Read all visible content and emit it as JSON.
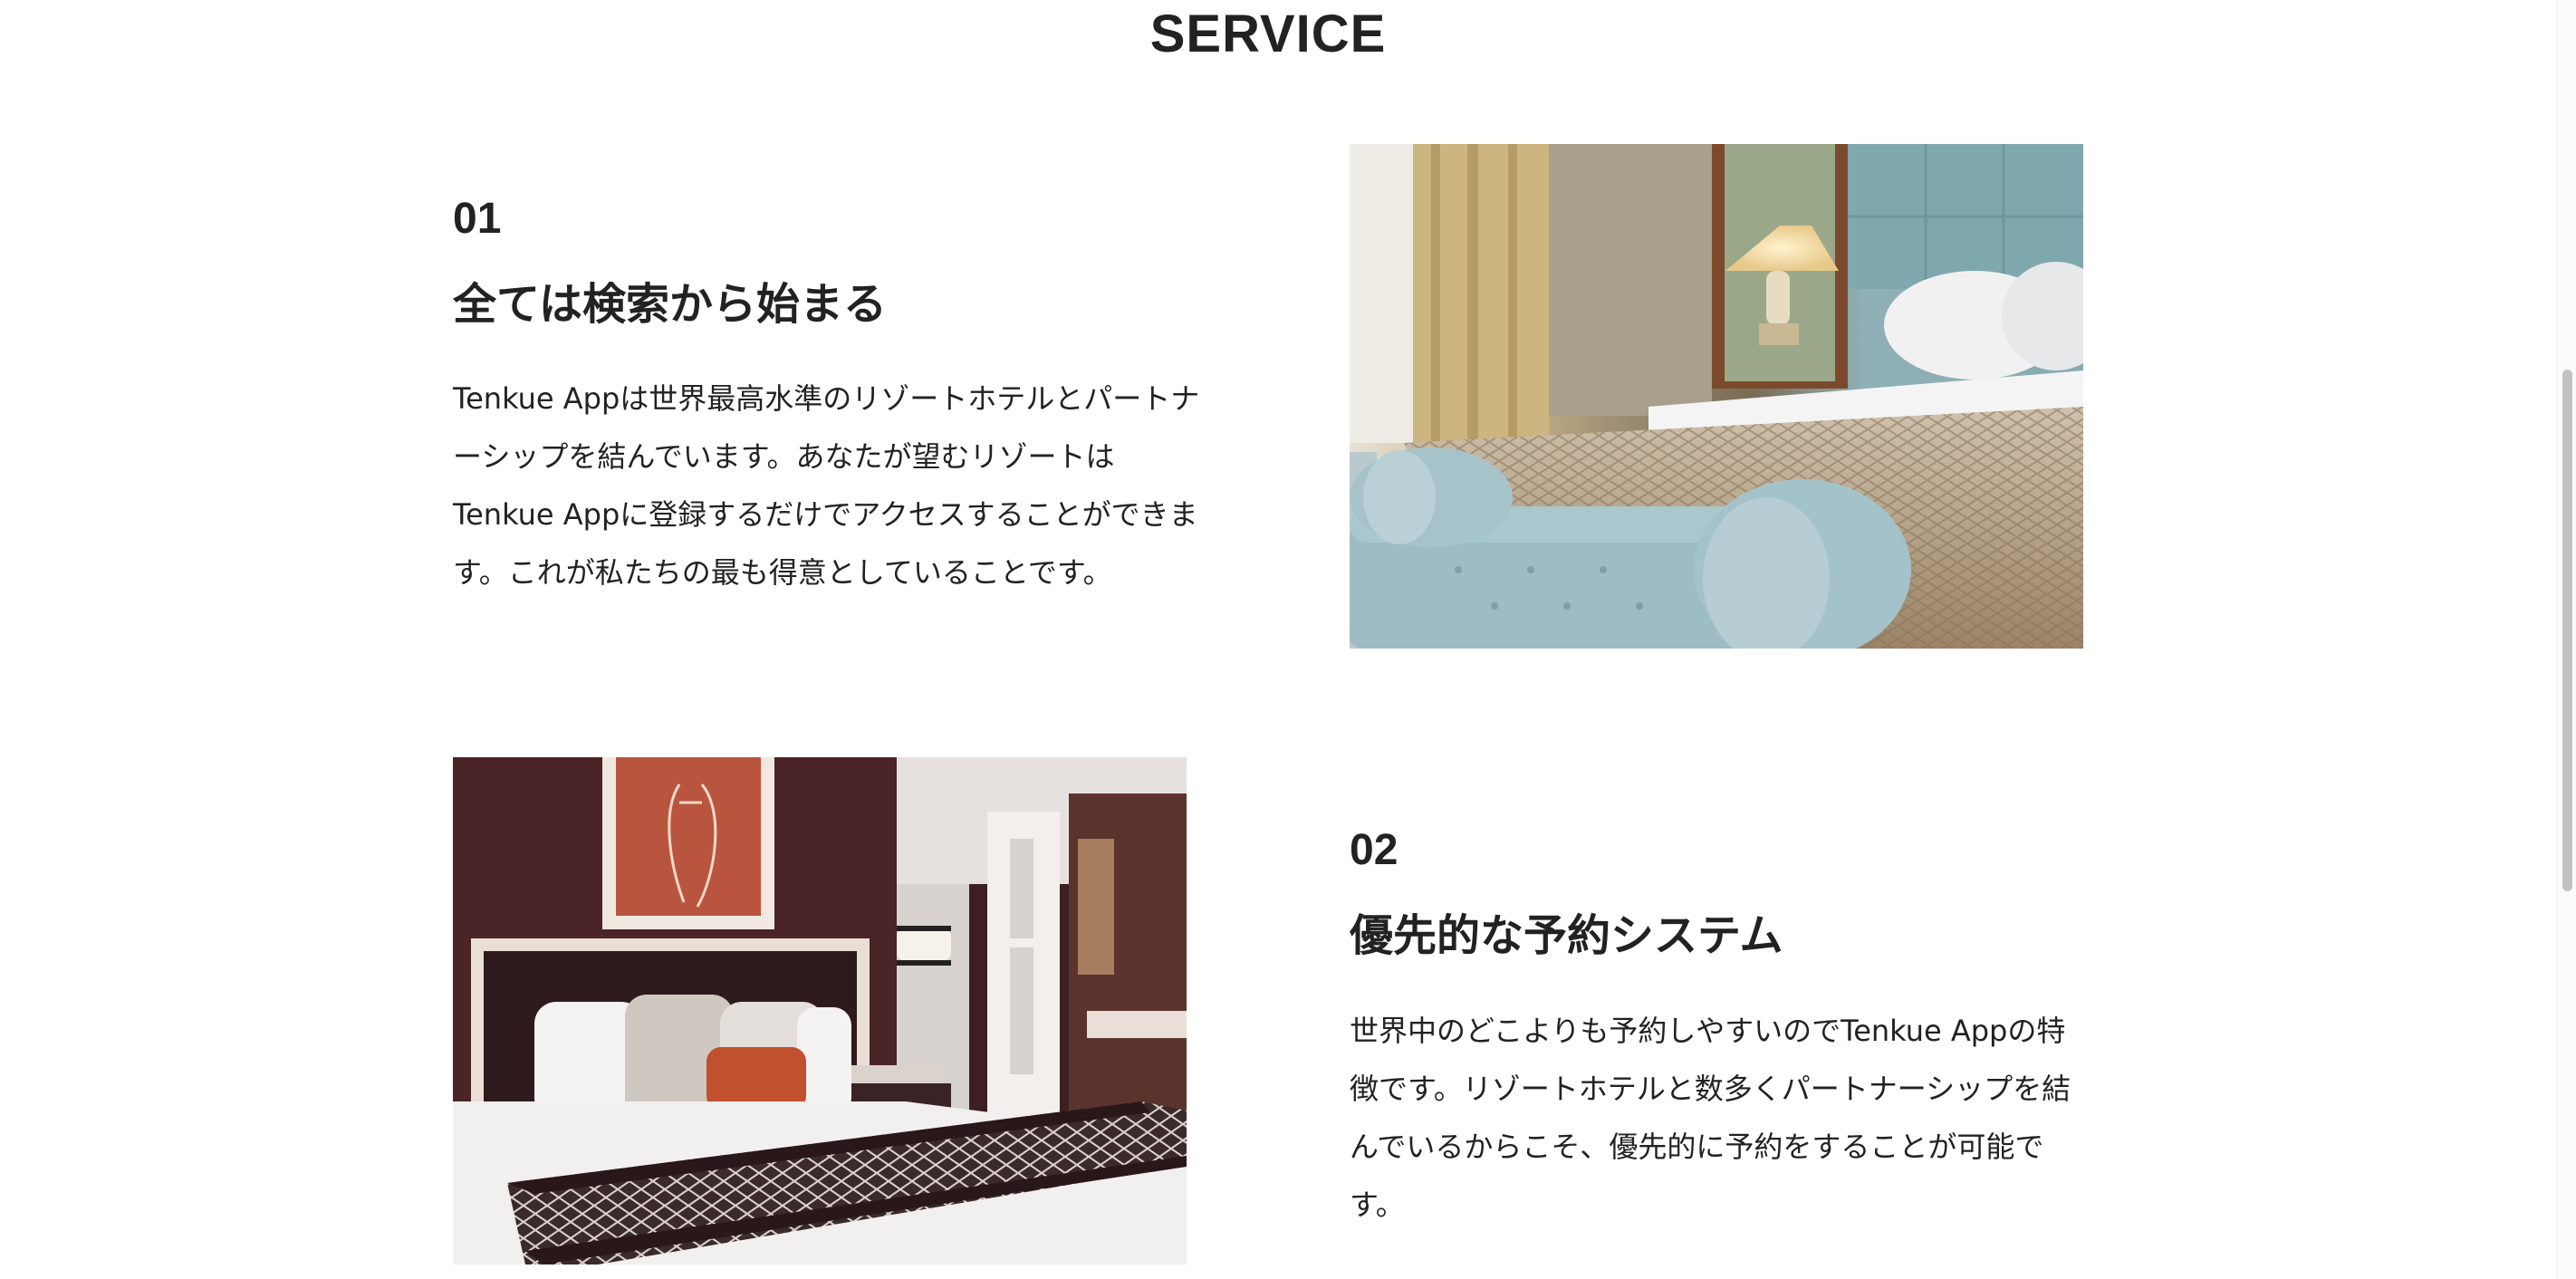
{
  "section": {
    "title": "SERVICE"
  },
  "services": [
    {
      "number": "01",
      "heading": "全ては検索から始まる",
      "lines": [
        "Tenkue Appは世界最高水準のリゾートホテルとパートナ",
        "ーシップを結んでいます。あなたが望むリゾートは",
        "Tenkue Appに登録するだけでアクセスすることができま",
        "す。これが私たちの最も得意としていることです。"
      ]
    },
    {
      "number": "02",
      "heading": "優先的な予約システム",
      "lines": [
        "世界中のどこよりも予約しやすいのでTenkue Appの特",
        "徴です。リゾートホテルと数多くパートナーシップを結",
        "んでいるからこそ、優先的に予約をすることが可能で",
        "す。"
      ]
    }
  ],
  "colors": {
    "text": "#222222",
    "background": "#ffffff",
    "scrollbar_thumb": "#c2c2c2"
  }
}
